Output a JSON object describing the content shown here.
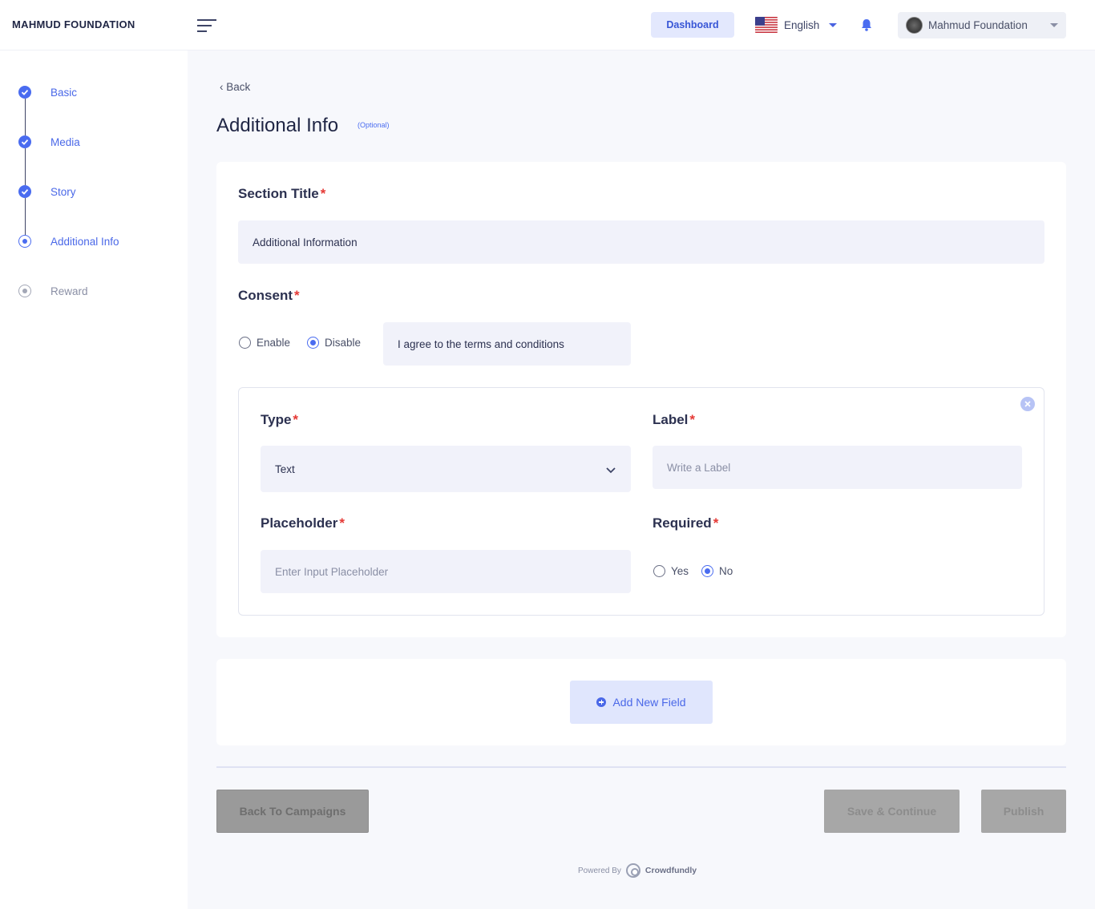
{
  "header": {
    "brand": "MAHMUD FOUNDATION",
    "dashboard_label": "Dashboard",
    "language": "English",
    "user_name": "Mahmud Foundation"
  },
  "sidebar": {
    "steps": [
      {
        "label": "Basic",
        "state": "done"
      },
      {
        "label": "Media",
        "state": "done"
      },
      {
        "label": "Story",
        "state": "done"
      },
      {
        "label": "Additional Info",
        "state": "active"
      },
      {
        "label": "Reward",
        "state": "pending"
      }
    ]
  },
  "page": {
    "back_label": "Back",
    "title": "Additional Info",
    "optional_tag": "(Optional)"
  },
  "form": {
    "section_title_label": "Section Title",
    "section_title_value": "Additional Information",
    "consent_label": "Consent",
    "consent_options": [
      {
        "label": "Enable",
        "selected": false
      },
      {
        "label": "Disable",
        "selected": true
      }
    ],
    "consent_text": "I agree to the terms and conditions",
    "field": {
      "type_label": "Type",
      "type_value": "Text",
      "label_label": "Label",
      "label_placeholder": "Write a Label",
      "placeholder_label": "Placeholder",
      "placeholder_placeholder": "Enter Input Placeholder",
      "required_label": "Required",
      "required_options": [
        {
          "label": "Yes",
          "selected": false
        },
        {
          "label": "No",
          "selected": true
        }
      ]
    },
    "required_mark": "*"
  },
  "actions": {
    "add_field": "Add New Field",
    "back_to_campaigns": "Back To Campaigns",
    "save_continue": "Save & Continue",
    "publish": "Publish"
  },
  "footer": {
    "powered_by": "Powered By",
    "brand": "Crowdfundly"
  },
  "colors": {
    "accent": "#4a6cf0",
    "required": "#e53935"
  }
}
